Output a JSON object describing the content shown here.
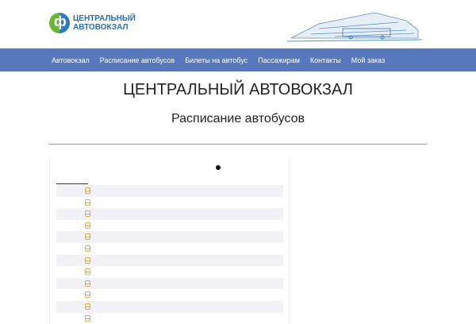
{
  "logo": {
    "line1": "ЦЕНТРАЛЬНЫЙ",
    "line2": "АВТОВОКЗАЛ"
  },
  "nav": [
    "Автовокзал",
    "Расписание автобусов",
    "Билеты на автобус",
    "Пассажирам",
    "Контакты",
    "Мой заказ"
  ],
  "page_title": "ЦЕНТРАЛЬНЫЙ АВТОВОКЗАЛ",
  "subtitle": "Расписание автобусов",
  "rows_count": 12,
  "colors": {
    "nav": "#5778bd",
    "bus_icon": "#e8a838"
  }
}
